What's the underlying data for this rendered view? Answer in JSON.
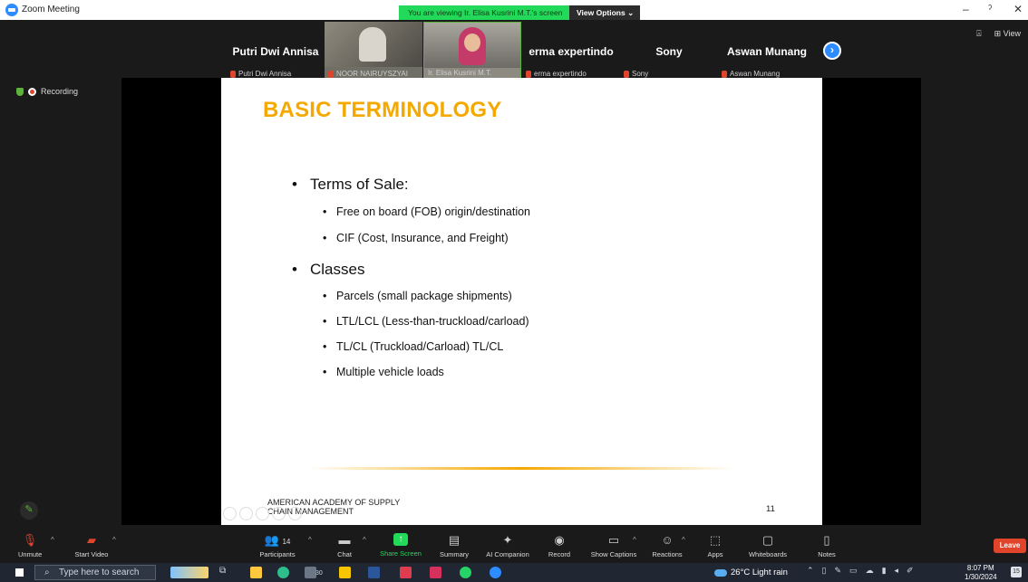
{
  "window": {
    "title": "Zoom Meeting",
    "viewing_banner": "You are viewing Ir. Elisa Kusrini M.T.'s screen",
    "view_options": "View Options",
    "view_options_caret": "⌄",
    "minimize": "–",
    "restore": "ˀ",
    "close": "✕"
  },
  "top_right": {
    "view_icon": "⊞",
    "view_label": "View"
  },
  "recording": {
    "label": "Recording"
  },
  "participants": [
    {
      "tile_name": "Putri Dwi Annisa",
      "sub": "Putri Dwi Annisa",
      "video": false
    },
    {
      "tile_name": "",
      "sub": "NOOR NAIRUYSZYAI",
      "video": true
    },
    {
      "tile_name": "",
      "sub": "Ir. Elisa Kusrini M.T.",
      "video": true,
      "active": true
    },
    {
      "tile_name": "erma expertindo",
      "sub": "erma expertindo",
      "video": false
    },
    {
      "tile_name": "Sony",
      "sub": "Sony",
      "video": false
    },
    {
      "tile_name": "Aswan Munang",
      "sub": "Aswan Munang",
      "video": false
    }
  ],
  "participants_next": "›",
  "slide": {
    "title": "BASIC TERMINOLOGY",
    "bullets": [
      {
        "level": 1,
        "text": "Terms of Sale:"
      },
      {
        "level": 2,
        "text": "Free on board (FOB) origin/destination"
      },
      {
        "level": 2,
        "text": "CIF (Cost, Insurance, and Freight)"
      },
      {
        "level": 1,
        "text": "Classes"
      },
      {
        "level": 2,
        "text": "Parcels  (small package shipments)"
      },
      {
        "level": 2,
        "text": "LTL/LCL (Less-than-truckload/carload)"
      },
      {
        "level": 2,
        "text": "TL/CL  (Truckload/Carload) TL/CL"
      },
      {
        "level": 2,
        "text": "Multiple vehicle loads"
      }
    ],
    "bullet_char": "•",
    "footer_line1": "AMERICAN ACADEMY OF SUPPLY",
    "footer_line2": "CHAIN MANAGEMENT",
    "page_number": "11",
    "accent_color": "#f5a800"
  },
  "toolbar": {
    "unmute": "Unmute",
    "start_video": "Start Video",
    "participants": "Participants",
    "participants_count": "14",
    "chat": "Chat",
    "share_screen": "Share Screen",
    "summary": "Summary",
    "ai_companion": "AI Companion",
    "record": "Record",
    "show_captions": "Show Captions",
    "reactions": "Reactions",
    "apps": "Apps",
    "whiteboards": "Whiteboards",
    "notes": "Notes",
    "leave": "Leave",
    "caret": "^"
  },
  "taskbar": {
    "search_placeholder": "Type here to search",
    "explorer_badge": "30",
    "weather": "26°C  Light rain",
    "time": "8:07 PM",
    "date": "1/30/2024",
    "notifications": "15"
  }
}
